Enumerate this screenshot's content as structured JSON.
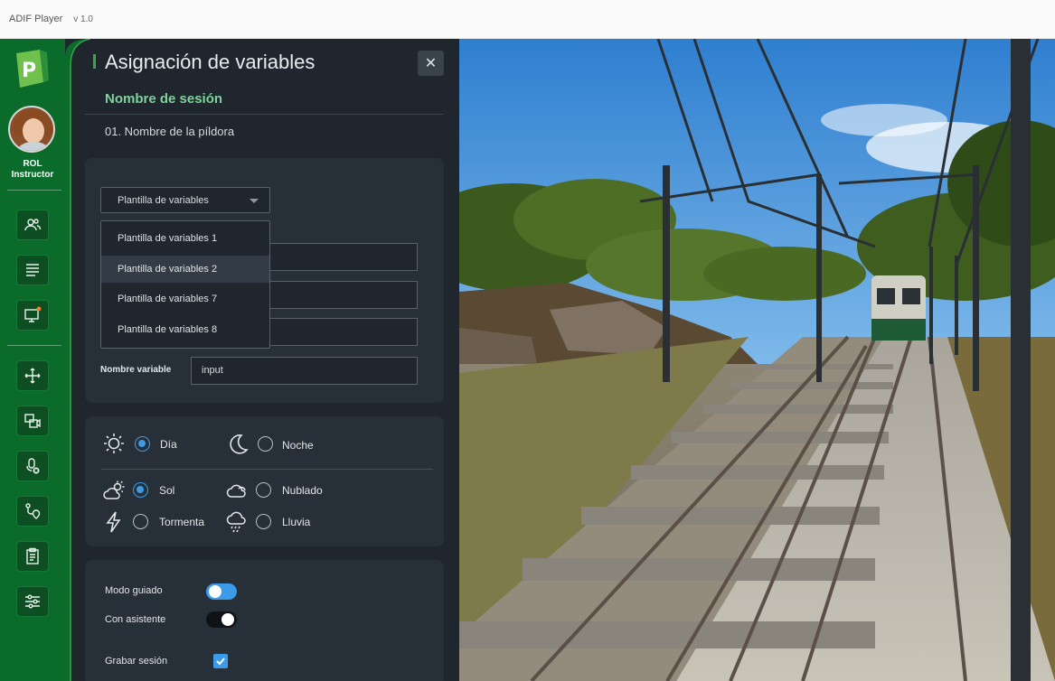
{
  "titlebar": {
    "app_name": "ADIF Player",
    "version": "v 1.0"
  },
  "sidebar": {
    "role_line1": "ROL",
    "role_line2": "Instructor",
    "nav": [
      {
        "icon": "users-icon"
      },
      {
        "icon": "list-icon"
      },
      {
        "icon": "monitor-icon"
      },
      {
        "icon": "move-icon"
      },
      {
        "icon": "camera-switch-icon"
      },
      {
        "icon": "microphone-off-icon"
      },
      {
        "icon": "route-icon"
      },
      {
        "icon": "clipboard-icon"
      },
      {
        "icon": "sliders-icon"
      }
    ]
  },
  "panel": {
    "title": "Asignación de variables",
    "close_symbol": "✕",
    "session_label": "Nombre de sesión",
    "pill_name": "01. Nombre de la píldora"
  },
  "variables": {
    "template_select": "Plantilla de variables",
    "dropdown_options": [
      "Plantilla de variables 1",
      "Plantilla de variables 2",
      "Plantilla de variables 7",
      "Plantilla de variables 8"
    ],
    "highlighted_option": "Plantilla de variables 2",
    "variable_name_label": "Nombre variable",
    "variable_name_value": "input"
  },
  "conditions": {
    "time": [
      {
        "label": "Día",
        "selected": true,
        "icon": "sun-icon"
      },
      {
        "label": "Noche",
        "selected": false,
        "icon": "moon-icon"
      }
    ],
    "weather": [
      {
        "label": "Sol",
        "selected": true,
        "icon": "partly-sunny-icon"
      },
      {
        "label": "Nublado",
        "selected": false,
        "icon": "cloud-icon"
      },
      {
        "label": "Tormenta",
        "selected": false,
        "icon": "lightning-icon"
      },
      {
        "label": "Lluvia",
        "selected": false,
        "icon": "rain-icon"
      }
    ]
  },
  "options": {
    "guided_mode_label": "Modo guiado",
    "guided_mode_on": true,
    "assistant_label": "Con asistente",
    "assistant_on": false,
    "record_label": "Grabar sesión",
    "record_checked": true
  },
  "colors": {
    "sidebar": "#0b6b2b",
    "panel": "#1f262e",
    "accent": "#3b9be8",
    "session_green": "#7fd39a"
  }
}
